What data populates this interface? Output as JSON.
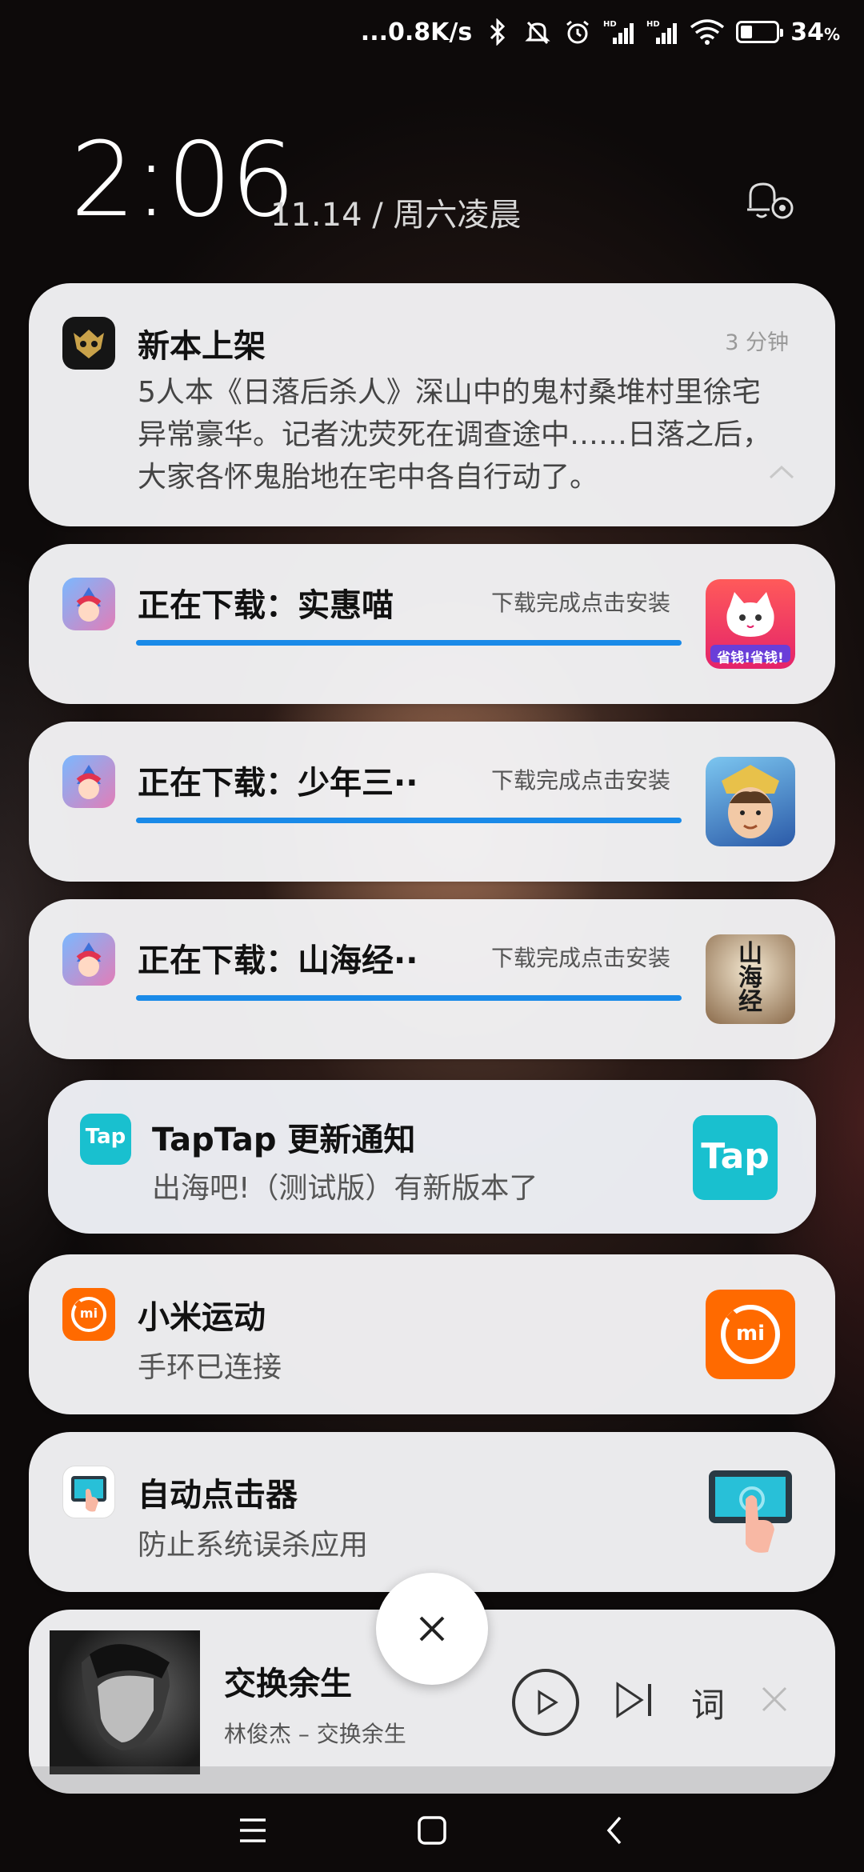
{
  "status_bar": {
    "net_speed": "...0.8K/s",
    "battery_percent": "34",
    "battery_unit": "%",
    "battery_level": 0.34,
    "icons": [
      "bluetooth-icon",
      "bell-muted-icon",
      "alarm-icon",
      "signal-hd-icon",
      "signal-hd-icon",
      "wifi-icon",
      "battery-icon"
    ],
    "hd_label": "HD"
  },
  "lockscreen": {
    "time": "2:06",
    "date": "11.14 / 周六凌晨"
  },
  "notifications": [
    {
      "app_icon": "dark-mask-icon",
      "title": "新本上架",
      "time": "3 分钟",
      "body": "5人本《日落后杀人》深山中的鬼村桑堆村里徐宅异常豪华。记者沈荧死在调查途中……日落之后，大家各怀鬼胎地在宅中各自行动了。"
    },
    {
      "app_icon": "game-store-icon",
      "title": "正在下载：实惠喵",
      "hint": "下载完成点击安装",
      "progress": 1.0,
      "thumb_icon": "cat-app-icon",
      "thumb_text": "省钱!省钱!"
    },
    {
      "app_icon": "game-store-icon",
      "title": "正在下载：少年三··",
      "hint": "下载完成点击安装",
      "progress": 1.0,
      "thumb_icon": "warrior-app-icon"
    },
    {
      "app_icon": "game-store-icon",
      "title": "正在下载：山海经··",
      "hint": "下载完成点击安装",
      "progress": 1.0,
      "thumb_icon": "shanhaijing-app-icon",
      "thumb_text": "山海经"
    },
    {
      "app_icon": "taptap-icon",
      "app_icon_text": "Tap",
      "title": "TapTap 更新通知",
      "subtitle": "出海吧!（测试版）有新版本了",
      "thumb_icon": "taptap-icon",
      "thumb_text": "Tap"
    },
    {
      "app_icon": "mi-fitness-icon",
      "app_icon_text": "mi",
      "title": "小米运动",
      "subtitle": "手环已连接",
      "thumb_icon": "mi-fitness-icon",
      "thumb_text": "mi"
    },
    {
      "app_icon": "auto-clicker-icon",
      "title": "自动点击器",
      "subtitle": "防止系统误杀应用",
      "thumb_icon": "auto-clicker-icon"
    }
  ],
  "media_player": {
    "song_title": "交换余生",
    "artist_line": "林俊杰 – 交换余生",
    "lyrics_label": "词",
    "buttons": [
      "play-icon",
      "skip-next-icon",
      "lyrics-button",
      "close-icon"
    ]
  },
  "clear_button": {
    "icon": "close-icon"
  },
  "nav_bar": {
    "buttons": [
      "menu-icon",
      "home-icon",
      "back-icon"
    ]
  },
  "colors": {
    "progress": "#1a8ae8",
    "taptap": "#19c0cf",
    "mi_orange": "#ff6a00",
    "card_bg": "#f4f4f6"
  }
}
